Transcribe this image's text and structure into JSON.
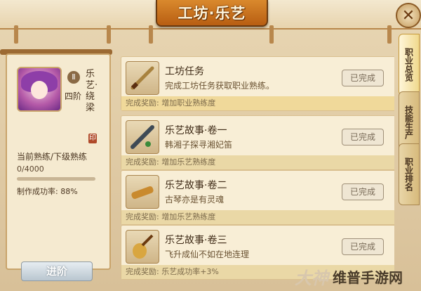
{
  "window": {
    "title": "工坊·乐艺",
    "close_icon": "close-icon"
  },
  "profile": {
    "rank_icon": "rank-badge-icon",
    "rank_glyph": "Ⅱ",
    "rank": "四阶",
    "class_name": "乐艺·绕梁",
    "class_seal": "印",
    "proficiency_label": "当前熟练/下级熟练",
    "proficiency_value": "0/4000",
    "proficiency_fraction": 0,
    "success_rate": "制作成功率: 88%"
  },
  "advance_button": "进阶",
  "tasks": [
    {
      "title": "工坊任务",
      "desc": "完成工坊任务获取职业熟练。",
      "status": "已完成",
      "reward": "完成奖励: 增加职业熟练度",
      "icon": "sword-icon"
    },
    {
      "title": "乐艺故事·卷一",
      "desc": "韩湘子探寻湘妃笛",
      "status": "已完成",
      "reward": "完成奖励: 增加乐艺熟练度",
      "icon": "flute-icon"
    },
    {
      "title": "乐艺故事·卷二",
      "desc": "古琴亦是有灵魂",
      "status": "已完成",
      "reward": "完成奖励: 增加乐艺熟练度",
      "icon": "guqin-icon"
    },
    {
      "title": "乐艺故事·卷三",
      "desc": "飞升成仙不如在地连理",
      "status": "已完成",
      "reward": "完成奖励: 乐艺成功率+3%",
      "icon": "pipa-icon"
    }
  ],
  "tabs": [
    "职业总览",
    "技能生产",
    "职业排名"
  ],
  "watermark": {
    "logo": "大神",
    "text": "维普手游网"
  }
}
